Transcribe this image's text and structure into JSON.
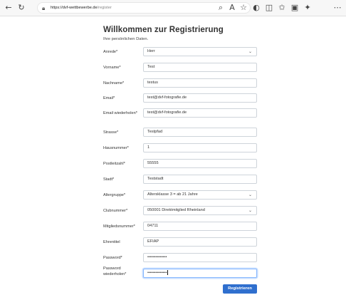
{
  "browser": {
    "url_host": "https://dvf-wettbewerbe.de",
    "url_path": "/register",
    "icons": {
      "back": "back-arrow-icon",
      "refresh": "refresh-icon",
      "lock": "lock-icon",
      "search": "search-icon",
      "read_aloud": "read-aloud-icon",
      "favorite": "star-icon",
      "extensions": "extension-icon",
      "split": "split-screen-icon",
      "favorites": "favorites-icon",
      "collections": "collections-icon",
      "copilot": "copilot-icon",
      "more": "more-icon"
    }
  },
  "form": {
    "title": "Willkommen zur Registrierung",
    "subtitle": "Ihre persönlichen Daten.",
    "fields": {
      "anrede": {
        "label": "Anrede*",
        "value": "Herr"
      },
      "vorname": {
        "label": "Vorname*",
        "value": "Test"
      },
      "nachname": {
        "label": "Nachname*",
        "value": "testus"
      },
      "email": {
        "label": "Email*",
        "value": "test@dvf-fotografie.de"
      },
      "email_repeat": {
        "label": "Email wiederholen*",
        "value": "test@dvf-fotografie.de"
      },
      "strasse": {
        "label": "Strasse*",
        "value": "Testpfad"
      },
      "hausnummer": {
        "label": "Hausnummer*",
        "value": "1"
      },
      "postleitzahl": {
        "label": "Postleitzahl*",
        "value": "55555"
      },
      "stadt": {
        "label": "Stadt*",
        "value": "Teststadt"
      },
      "altergruppe": {
        "label": "Altergruppe*",
        "value": "Altersklasse 3 = ab 21 Jahre"
      },
      "clubnummer": {
        "label": "Clubnummer*",
        "value": "050001 Direktmitglied Rheinland"
      },
      "mitgliedsnummer": {
        "label": "Mitgliedsnummer*",
        "value": "04711"
      },
      "ehrentitel": {
        "label": "Ehrentitel",
        "value": "EFIAP"
      },
      "password": {
        "label": "Password*",
        "value": "••••••••••••••"
      },
      "password_repeat": {
        "label": "Password wiederholen*",
        "value": "••••••••••••••"
      }
    },
    "submit_label": "Registrieren",
    "colors": {
      "primary": "#2f6fce",
      "focus_border": "#86b7fe",
      "input_border": "#ced4da"
    }
  }
}
